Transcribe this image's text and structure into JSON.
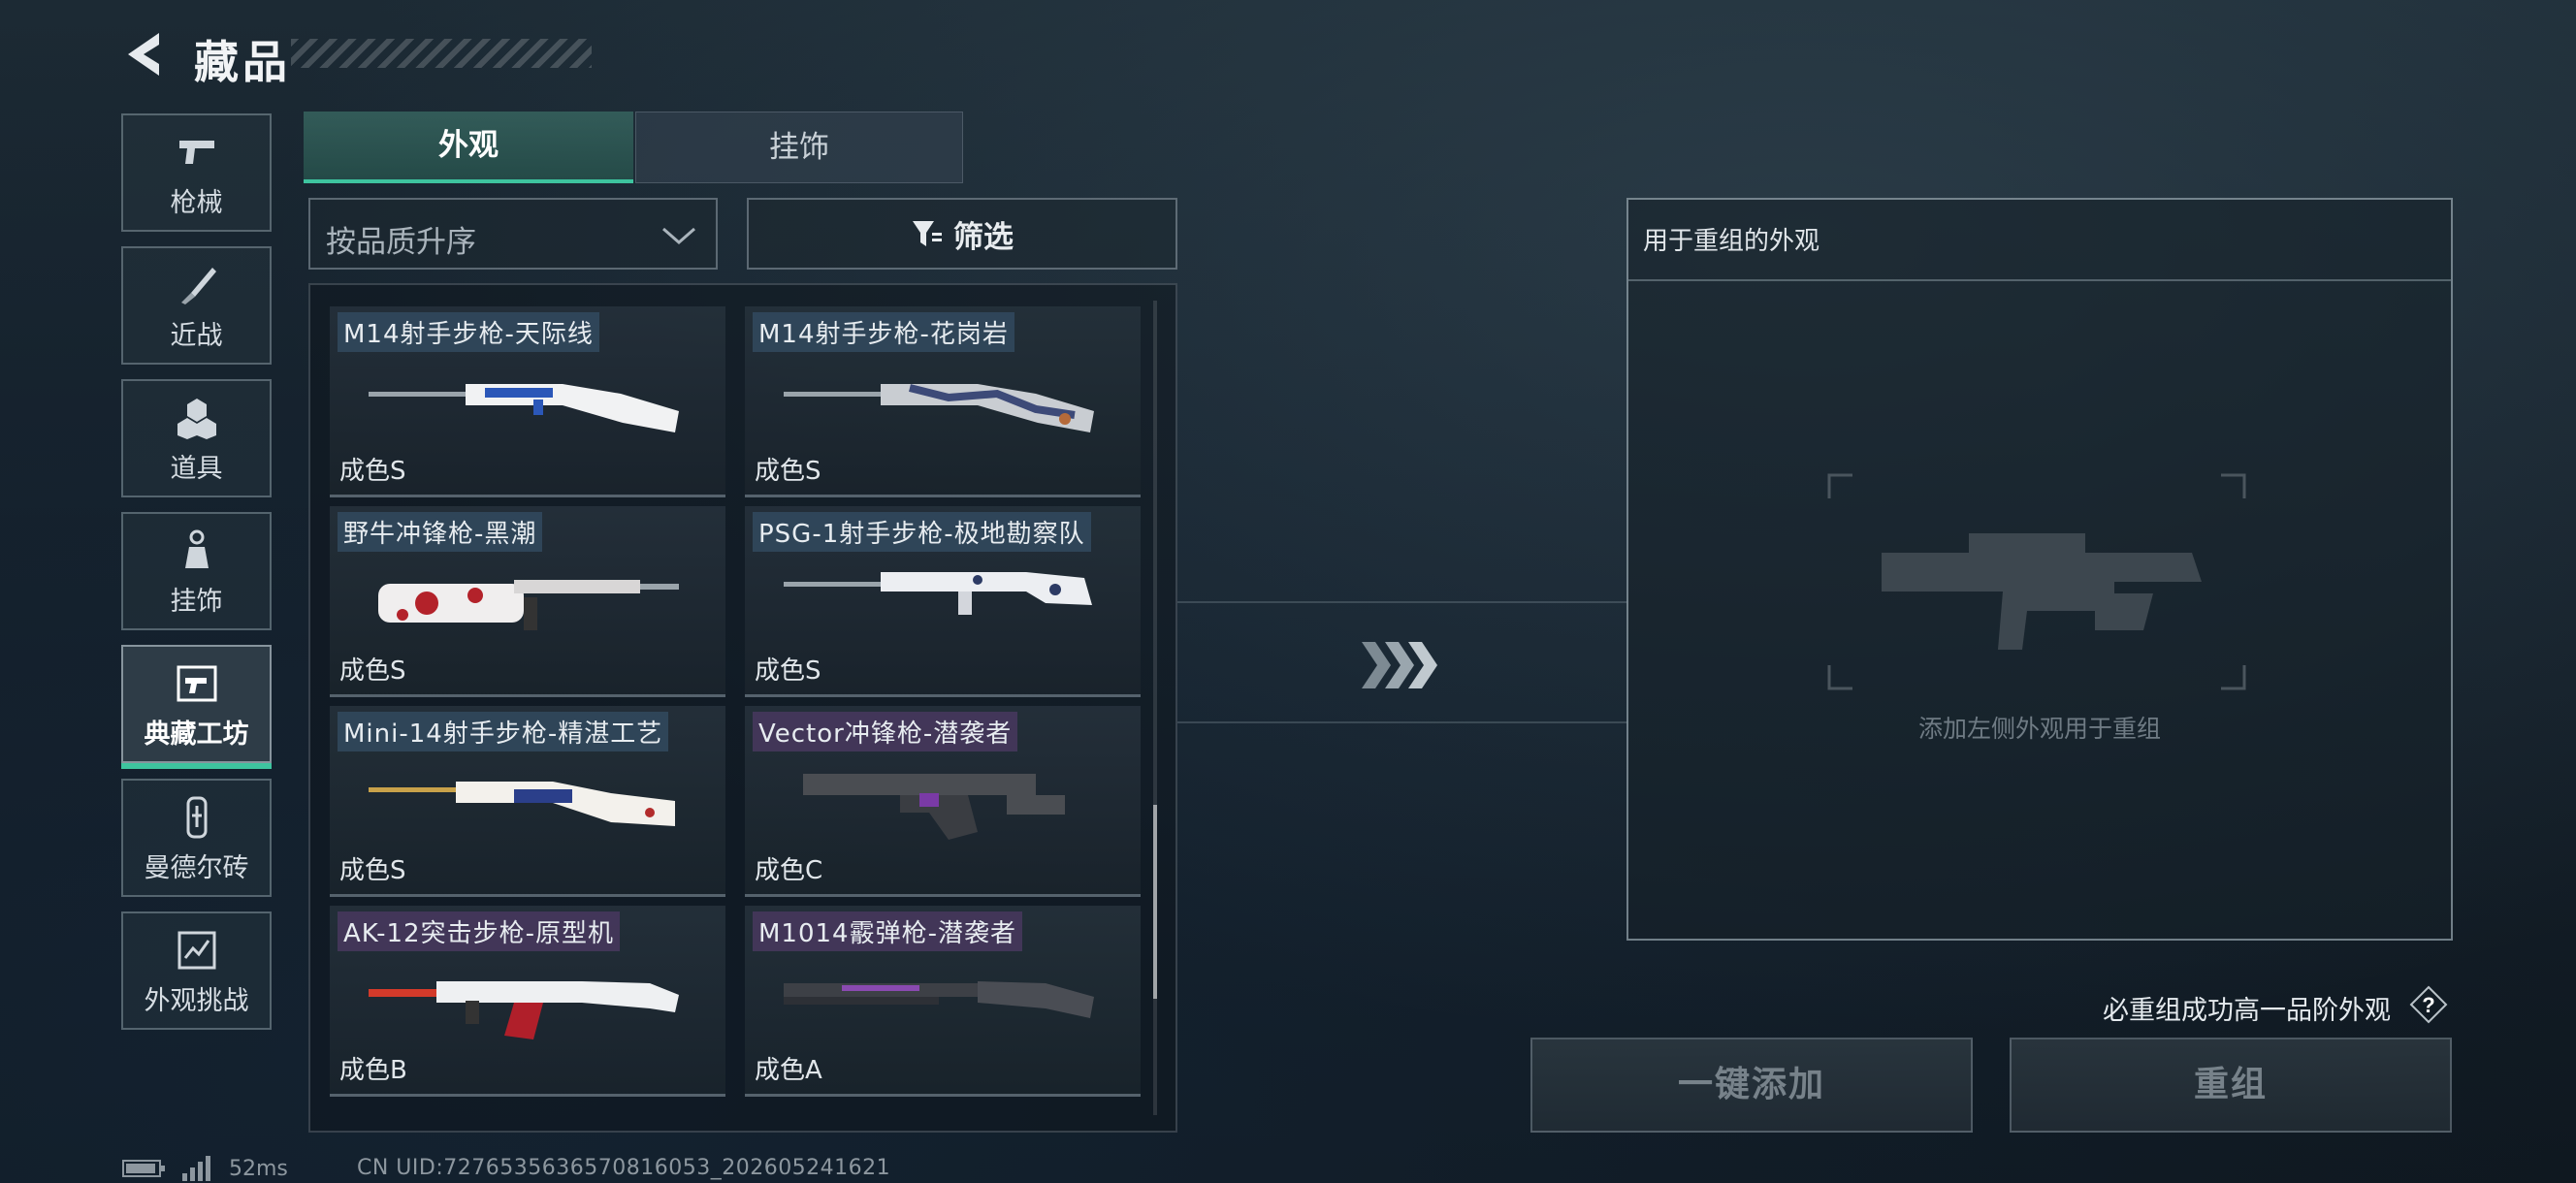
{
  "header": {
    "title": "藏品"
  },
  "sidebar": {
    "items": [
      {
        "label": "枪械",
        "icon": "pistol-icon"
      },
      {
        "label": "近战",
        "icon": "knife-icon"
      },
      {
        "label": "道具",
        "icon": "grenade-icon"
      },
      {
        "label": "挂饰",
        "icon": "keychain-icon"
      },
      {
        "label": "典藏工坊",
        "icon": "workshop-icon",
        "active": true
      },
      {
        "label": "曼德尔砖",
        "icon": "brick-icon"
      },
      {
        "label": "外观挑战",
        "icon": "challenge-icon"
      }
    ]
  },
  "tabs": [
    {
      "label": "外观",
      "active": true
    },
    {
      "label": "挂饰"
    }
  ],
  "sort": {
    "value": "按品质升序"
  },
  "filter": {
    "label": "筛选"
  },
  "items": [
    {
      "name": "M14射手步枪-天际线",
      "quality": "成色S",
      "tag": "blue"
    },
    {
      "name": "M14射手步枪-花岗岩",
      "quality": "成色S",
      "tag": "blue"
    },
    {
      "name": "野牛冲锋枪-黑潮",
      "quality": "成色S",
      "tag": "blue"
    },
    {
      "name": "PSG-1射手步枪-极地勘察队",
      "quality": "成色S",
      "tag": "blue"
    },
    {
      "name": "Mini-14射手步枪-精湛工艺",
      "quality": "成色S",
      "tag": "blue"
    },
    {
      "name": "Vector冲锋枪-潜袭者",
      "quality": "成色C",
      "tag": "purple"
    },
    {
      "name": "AK-12突击步枪-原型机",
      "quality": "成色B",
      "tag": "purple"
    },
    {
      "name": "M1014霰弹枪-潜袭者",
      "quality": "成色A",
      "tag": "purple"
    }
  ],
  "panel": {
    "title": "用于重组的外观",
    "hint": "添加左侧外观用于重组"
  },
  "note": "必重组成功高一品阶外观",
  "buttons": {
    "add_all": "一键添加",
    "reform": "重组"
  },
  "status": {
    "ping": "52ms",
    "uid": "CN UID:7276535636570816053_202605241621"
  },
  "colors": {
    "accent": "#3ec49f",
    "tag_blue": "#344e64",
    "tag_purple": "#4e3a64"
  }
}
